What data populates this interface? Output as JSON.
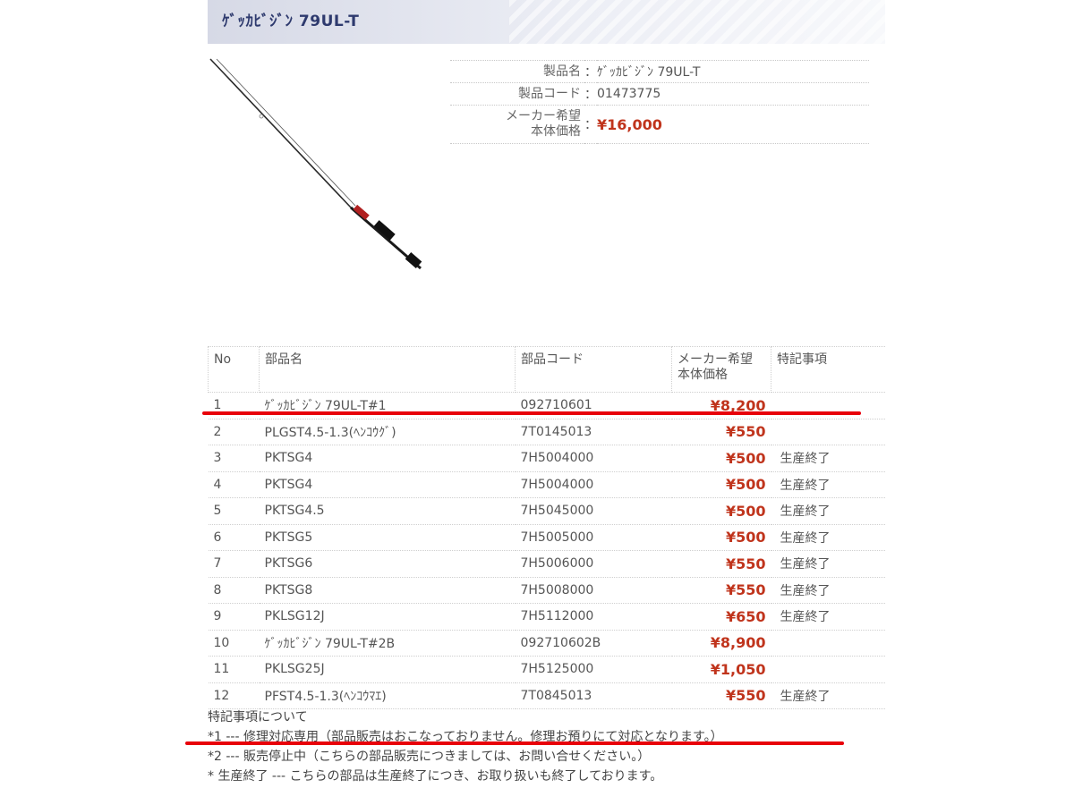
{
  "header": {
    "title": "ｹﾞｯｶﾋﾞｼﾞﾝ 79UL-T"
  },
  "product": {
    "name_label": "製品名",
    "name": "ｹﾞｯｶﾋﾞｼﾞﾝ 79UL-T",
    "code_label": "製品コード",
    "code": "01473775",
    "price_label_1": "メーカー希望",
    "price_label_2": "本体価格",
    "price": "¥16,000",
    "colon": "："
  },
  "parts_table": {
    "headers": {
      "no": "No",
      "name": "部品名",
      "code": "部品コード",
      "price_1": "メーカー希望",
      "price_2": "本体価格",
      "notes": "特記事項"
    },
    "rows": [
      {
        "no": "1",
        "name": "ｹﾞｯｶﾋﾞｼﾞﾝ 79UL-T#1",
        "code": "092710601",
        "price": "¥8,200",
        "note": ""
      },
      {
        "no": "2",
        "name": "PLGST4.5-1.3(ﾍﾝｺｳｸﾞ)",
        "code": "7T0145013",
        "price": "¥550",
        "note": ""
      },
      {
        "no": "3",
        "name": "PKTSG4",
        "code": "7H5004000",
        "price": "¥500",
        "note": "生産終了"
      },
      {
        "no": "4",
        "name": "PKTSG4",
        "code": "7H5004000",
        "price": "¥500",
        "note": "生産終了"
      },
      {
        "no": "5",
        "name": "PKTSG4.5",
        "code": "7H5045000",
        "price": "¥500",
        "note": "生産終了"
      },
      {
        "no": "6",
        "name": "PKTSG5",
        "code": "7H5005000",
        "price": "¥500",
        "note": "生産終了"
      },
      {
        "no": "7",
        "name": "PKTSG6",
        "code": "7H5006000",
        "price": "¥550",
        "note": "生産終了"
      },
      {
        "no": "8",
        "name": "PKTSG8",
        "code": "7H5008000",
        "price": "¥550",
        "note": "生産終了"
      },
      {
        "no": "9",
        "name": "PKLSG12J",
        "code": "7H5112000",
        "price": "¥650",
        "note": "生産終了"
      },
      {
        "no": "10",
        "name": "ｹﾞｯｶﾋﾞｼﾞﾝ 79UL-T#2B",
        "code": "092710602B",
        "price": "¥8,900",
        "note": ""
      },
      {
        "no": "11",
        "name": "PKLSG25J",
        "code": "7H5125000",
        "price": "¥1,050",
        "note": ""
      },
      {
        "no": "12",
        "name": "PFST4.5-1.3(ﾍﾝｺｳﾏｴ)",
        "code": "7T0845013",
        "price": "¥550",
        "note": "生産終了"
      }
    ]
  },
  "notes": {
    "heading": "特記事項について",
    "line1": "*1 --- 修理対応専用（部品販売はおこなっておりません。修理お預りにて対応となります。）",
    "line2": "*2 --- 販売停止中（こちらの部品販売につきましては、お問い合せください。）",
    "line3": "* 生産終了 --- こちらの部品は生産終了につき、お取り扱いも終了しております。"
  },
  "colors": {
    "price": "#c0341c",
    "annotation": "#e8000b",
    "header_text": "#2e3a6e"
  }
}
